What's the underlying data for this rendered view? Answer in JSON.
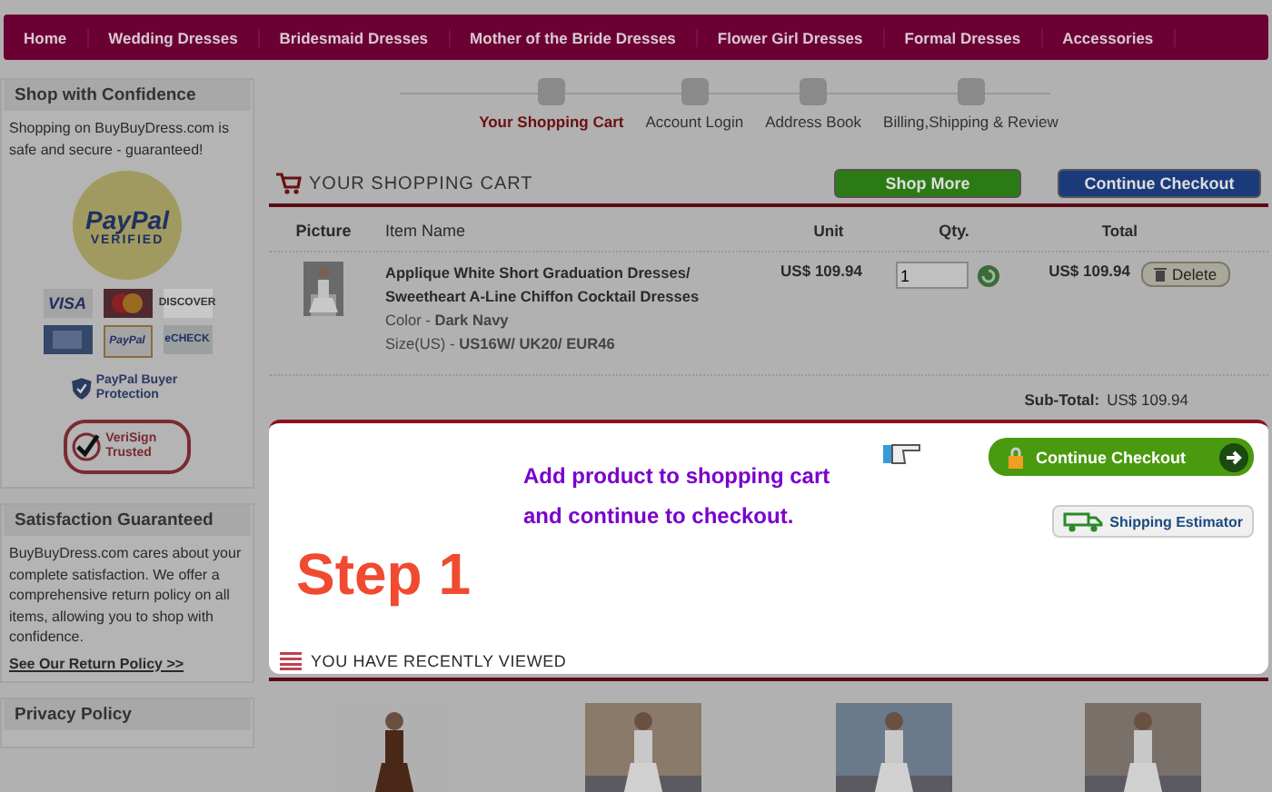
{
  "nav": [
    {
      "label": "Home"
    },
    {
      "label": "Wedding Dresses"
    },
    {
      "label": "Bridesmaid Dresses"
    },
    {
      "label": "Mother of the Bride Dresses"
    },
    {
      "label": "Flower Girl Dresses"
    },
    {
      "label": "Formal Dresses"
    },
    {
      "label": "Accessories"
    }
  ],
  "sidebar": {
    "boxes": [
      {
        "kind": "trust",
        "title": "Shop with Confidence",
        "text": "Shopping on BuyBuyDress.com is safe and secure - guaranteed!",
        "seal": [
          "PayPal",
          "VERIFIED"
        ],
        "cards": [
          {
            "kind": "text",
            "label": "VISA"
          },
          {
            "kind": "circles"
          },
          {
            "kind": "text",
            "label": "DISCOVER"
          },
          {
            "kind": "plain"
          },
          {
            "kind": "text",
            "label": "PayPal"
          },
          {
            "kind": "text",
            "label": "eCHECK"
          }
        ],
        "protection": "PayPal Buyer Protection",
        "verisign": "VeriSign Trusted"
      },
      {
        "kind": "text",
        "title": "Satisfaction Guaranteed",
        "text": "BuyBuyDress.com cares about your complete satisfaction. We offer a comprehensive return policy on all items, allowing you to shop with confidence.",
        "link": "See Our Return Policy >>"
      },
      {
        "kind": "title",
        "title": "Privacy Policy"
      }
    ]
  },
  "steps": [
    {
      "label": "Your Shopping Cart",
      "selected": true
    },
    {
      "label": "Account Login",
      "selected": false
    },
    {
      "label": "Address Book",
      "selected": false
    },
    {
      "label": "Billing,Shipping & Review",
      "selected": false
    }
  ],
  "cart": {
    "title": "YOUR SHOPPING CART",
    "shop_more": "Shop More",
    "checkout": "Continue Checkout",
    "columns": [
      "Picture",
      "Item Name",
      "Unit",
      "Qty.",
      "Total"
    ],
    "rows": [
      {
        "name": "Applique White Short Graduation Dresses/ Sweetheart A-Line Chiffon Cocktail Dresses",
        "color_label": "Color - ",
        "color_value": "Dark Navy",
        "size_label": "Size(US) - ",
        "size": "US16W/ UK20/ EUR46",
        "unit": "US$ 109.94",
        "qty": "1",
        "total": "US$ 109.94",
        "delete": "Delete"
      }
    ],
    "subtotal_label": "Sub-Total:",
    "subtotal": "US$ 109.94"
  },
  "highlight": {
    "message": "Add product to shopping cart and continue to checkout.",
    "checkout": "Continue Checkout",
    "shipping": "Shipping Estimator",
    "step": "Step 1",
    "recent": "YOU HAVE RECENTLY VIEWED"
  }
}
